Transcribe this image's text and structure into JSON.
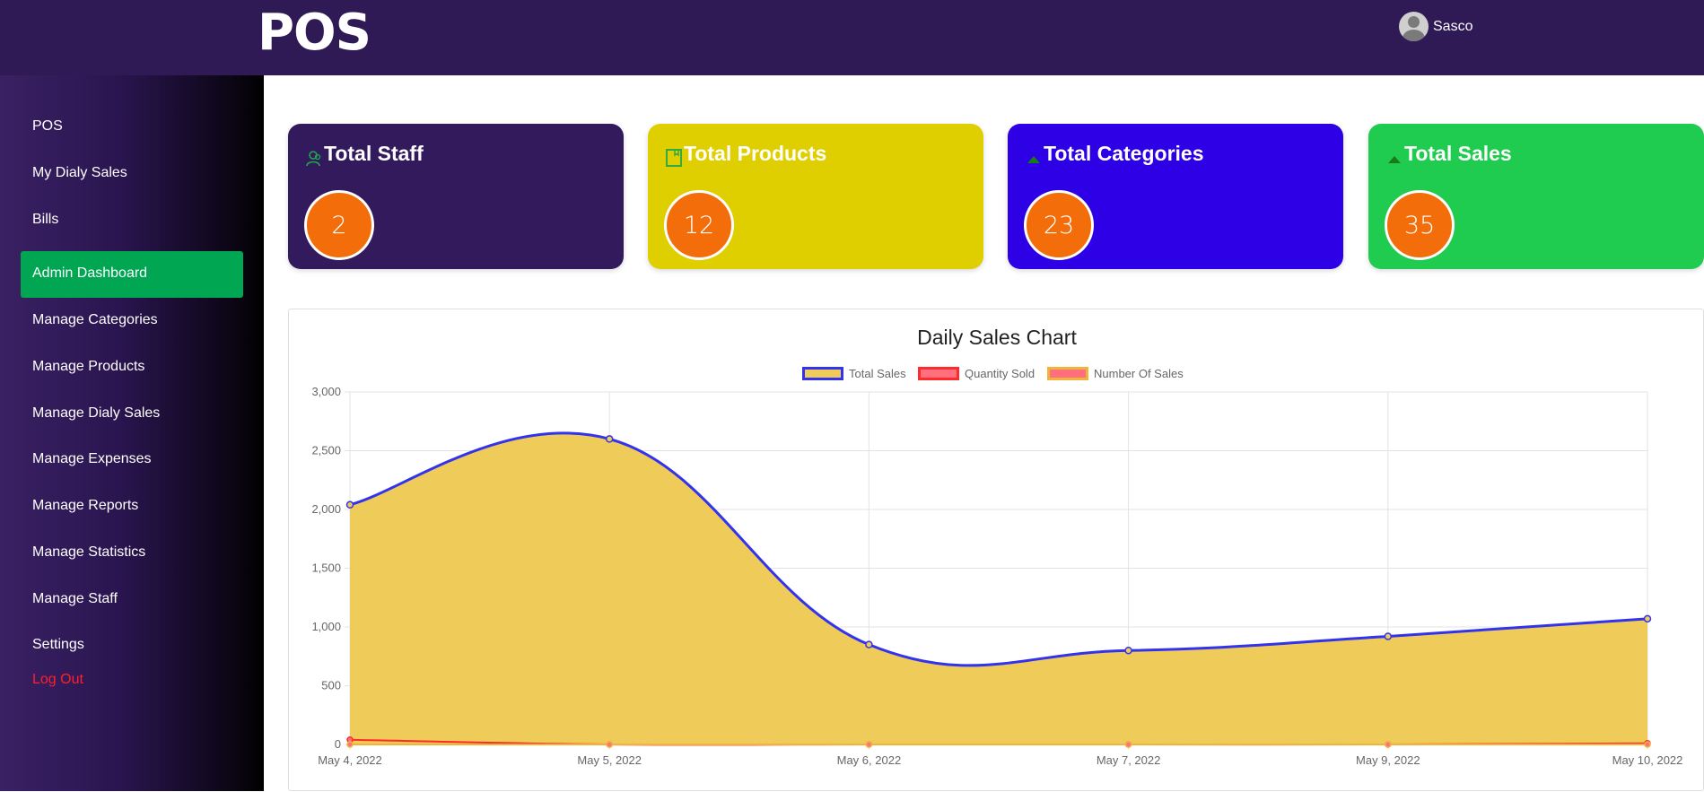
{
  "app": {
    "logo": "POS",
    "user_name": "Sasco"
  },
  "sidebar": {
    "items": [
      {
        "label": "POS"
      },
      {
        "label": "My Dialy Sales"
      },
      {
        "label": "Bills"
      },
      {
        "label": "Admin Dashboard",
        "active": true
      },
      {
        "label": "Manage Categories"
      },
      {
        "label": "Manage Products"
      },
      {
        "label": "Manage Dialy Sales"
      },
      {
        "label": "Manage Expenses"
      },
      {
        "label": "Manage Reports"
      },
      {
        "label": "Manage Statistics"
      },
      {
        "label": "Manage Staff"
      },
      {
        "label": "Settings"
      },
      {
        "label": "Log Out"
      }
    ]
  },
  "cards": [
    {
      "title": "Total Staff",
      "value": "2",
      "icon": "users-icon",
      "color": "#321a5c"
    },
    {
      "title": "Total Products",
      "value": "12",
      "icon": "bookmark-icon",
      "color": "#e0cf00"
    },
    {
      "title": "Total Categories",
      "value": "23",
      "icon": "caret-up-icon",
      "color": "#2d00e6"
    },
    {
      "title": "Total Sales",
      "value": "35",
      "icon": "caret-up-icon",
      "color": "#1fcc4f"
    }
  ],
  "chart_data": {
    "type": "area",
    "title": "Daily Sales Chart",
    "x": [
      "May 4, 2022",
      "May 5, 2022",
      "May 6, 2022",
      "May 7, 2022",
      "May 9, 2022",
      "May 10, 2022"
    ],
    "yticks": [
      "0",
      "500",
      "1,000",
      "1,500",
      "2,000",
      "2,500",
      "3,000"
    ],
    "ylim": [
      0,
      3000
    ],
    "grid": true,
    "legend_position": "top",
    "series": [
      {
        "name": "Total Sales",
        "values": [
          2040,
          2600,
          850,
          800,
          920,
          1070
        ],
        "line_color": "#3333ee",
        "fill_color": "#efcb5a"
      },
      {
        "name": "Quantity Sold",
        "values": [
          40,
          0,
          0,
          0,
          0,
          10
        ],
        "line_color": "#ff2a2a",
        "fill_color": "#ff6f7e"
      },
      {
        "name": "Number Of Sales",
        "values": [
          0,
          0,
          0,
          0,
          0,
          0
        ],
        "line_color": "#f0b43c",
        "fill_color": "#ff6f7e"
      }
    ]
  }
}
